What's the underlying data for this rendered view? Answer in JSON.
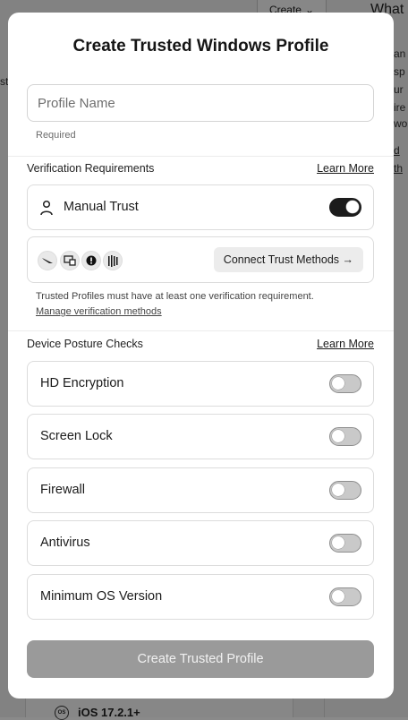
{
  "background": {
    "create_label": "Create",
    "what_label": "What",
    "side_fragments": [
      "an",
      "sp",
      "ur",
      "ire",
      "wor",
      "d th"
    ],
    "left_fragment": "st",
    "bottom_item": "iOS 17.2.1+"
  },
  "modal": {
    "title": "Create Trusted Windows Profile",
    "profile_name": {
      "value": "",
      "placeholder": "Profile Name",
      "hint": "Required"
    },
    "verification": {
      "heading": "Verification Requirements",
      "learn_more": "Learn More",
      "manual_trust": {
        "label": "Manual Trust",
        "enabled": true
      },
      "methods": {
        "icons": [
          "crowdstrike-icon",
          "intune-icon",
          "info-shield-icon",
          "barcode-icon"
        ],
        "connect_label": "Connect Trust Methods →"
      },
      "note": "Trusted Profiles must have at least one verification requirement.",
      "manage_link": "Manage verification methods"
    },
    "posture": {
      "heading": "Device Posture Checks",
      "learn_more": "Learn More",
      "checks": [
        {
          "label": "HD Encryption",
          "enabled": false
        },
        {
          "label": "Screen Lock",
          "enabled": false
        },
        {
          "label": "Firewall",
          "enabled": false
        },
        {
          "label": "Antivirus",
          "enabled": false
        },
        {
          "label": "Minimum OS Version",
          "enabled": false
        }
      ]
    },
    "submit_label": "Create Trusted Profile"
  },
  "colors": {
    "toggle_on": "#1c1c1c",
    "toggle_off": "#c9c9c9",
    "submit_disabled": "#9a9a9a"
  }
}
